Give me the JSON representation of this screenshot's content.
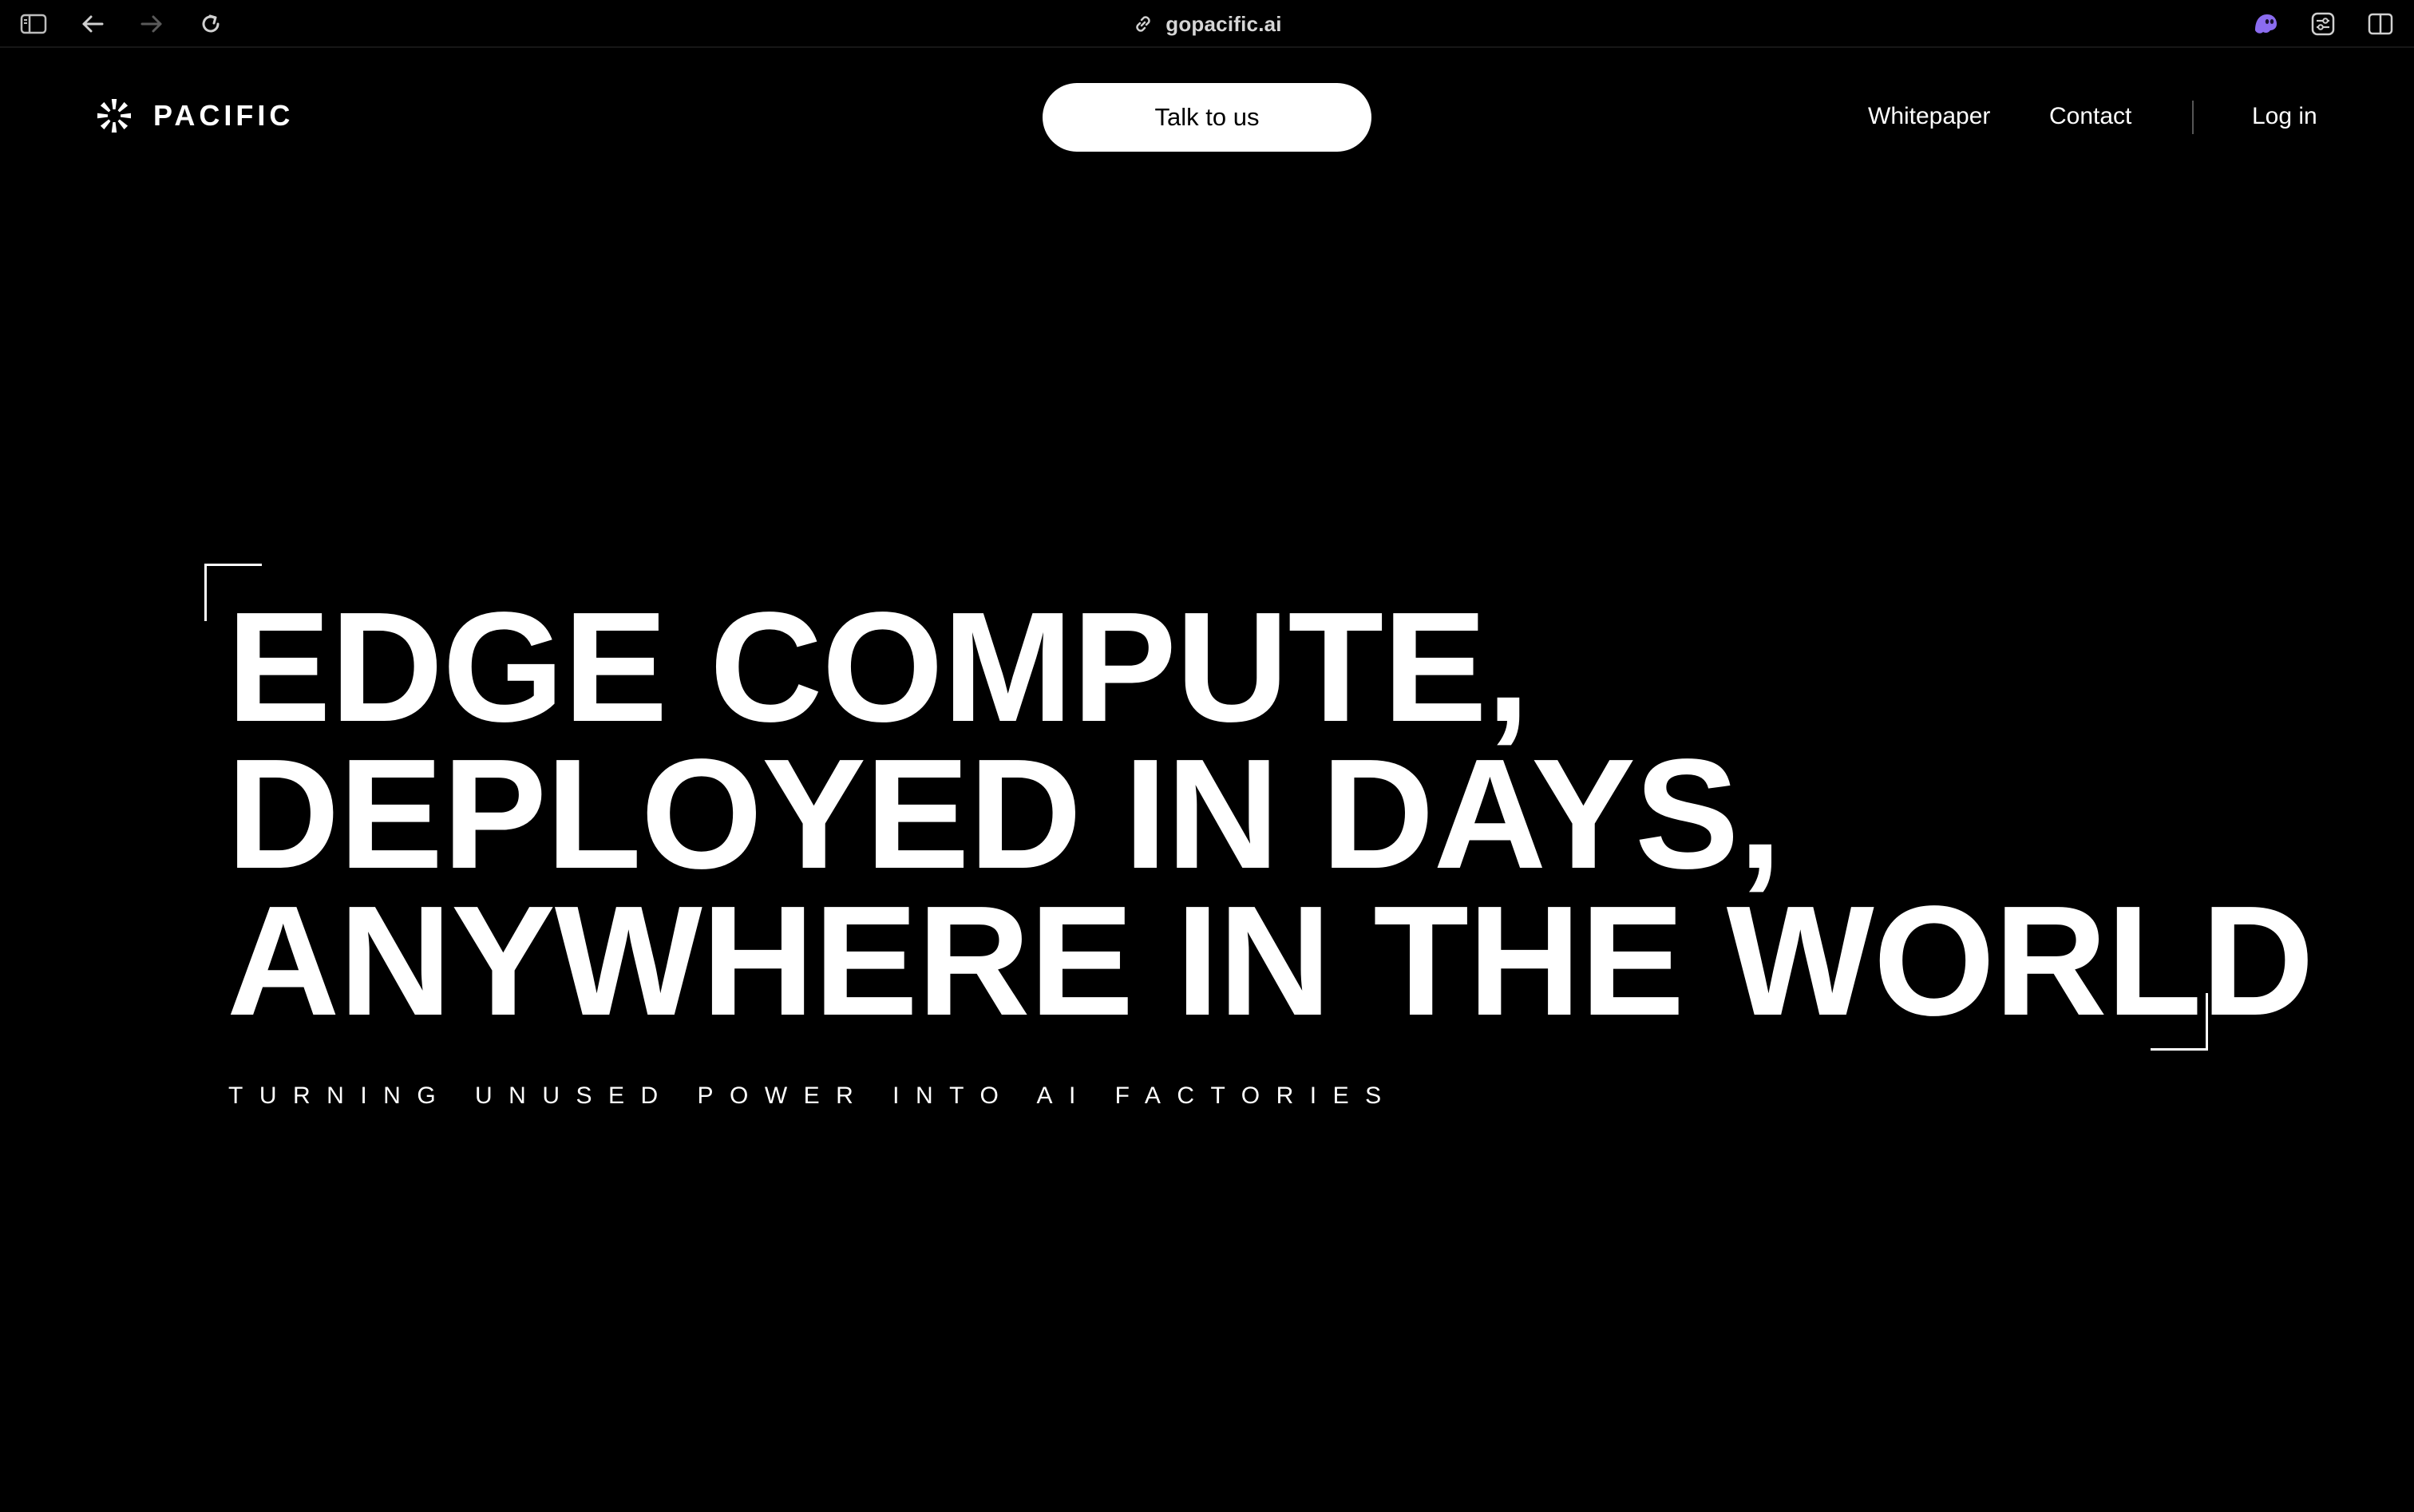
{
  "browser": {
    "url": "gopacific.ai",
    "icons": [
      "sidebar-icon",
      "back-arrow-icon",
      "forward-arrow-icon",
      "reload-icon",
      "link-icon",
      "extension-ghost-icon",
      "extension-tune-icon",
      "split-view-icon"
    ]
  },
  "header": {
    "logo_text": "PACIFIC",
    "cta_label": "Talk to us",
    "nav": {
      "whitepaper": "Whitepaper",
      "contact": "Contact",
      "login": "Log in"
    }
  },
  "hero": {
    "title_lines": [
      "EDGE COMPUTE,",
      "DEPLOYED IN DAYS,",
      "ANYWHERE IN THE WORLD"
    ],
    "subtitle": "TURNING UNUSED POWER INTO AI FACTORIES"
  },
  "colors": {
    "background": "#000000",
    "text": "#ffffff",
    "button_bg": "#ffffff",
    "button_text": "#000000",
    "extension_accent": "#8b6cf0"
  }
}
